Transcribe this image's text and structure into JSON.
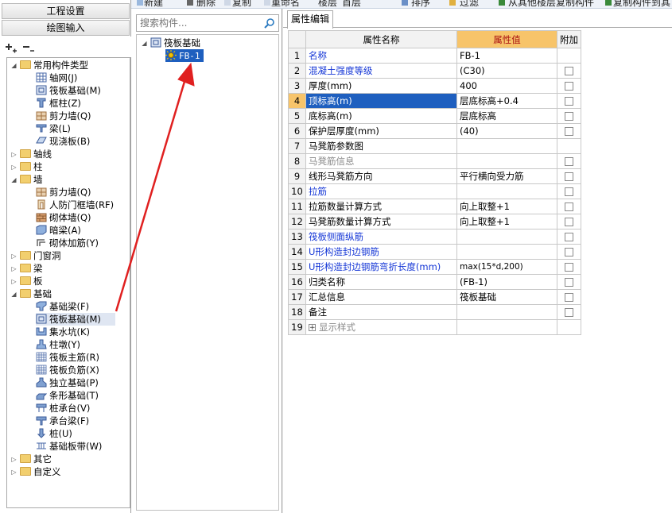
{
  "toolbar": {
    "new_label": "新建",
    "delete_label": "删除",
    "copy_label": "复制",
    "rename_label": "重命名",
    "floor_label": "楼层",
    "floor_value": "首层",
    "sort_label": "排序",
    "filter_label": "过滤",
    "copy_from_floor_label": "从其他楼层复制构件",
    "copy_to_floor_label": "复制构件到其"
  },
  "left_nav": {
    "project_settings": "工程设置",
    "drawing_input": "绘图输入"
  },
  "left_tree": {
    "common_types": "常用构件类型",
    "common_children": [
      "轴网(J)",
      "筏板基础(M)",
      "框柱(Z)",
      "剪力墙(Q)",
      "梁(L)",
      "现浇板(B)"
    ],
    "axis": "轴线",
    "column": "柱",
    "wall": "墙",
    "wall_children": [
      "剪力墙(Q)",
      "人防门框墙(RF)",
      "砌体墙(Q)",
      "暗梁(A)",
      "砌体加筋(Y)"
    ],
    "door_window": "门窗洞",
    "beam": "梁",
    "slab": "板",
    "foundation": "基础",
    "foundation_children": [
      "基础梁(F)",
      "筏板基础(M)",
      "集水坑(K)",
      "柱墩(Y)",
      "筏板主筋(R)",
      "筏板负筋(X)",
      "独立基础(P)",
      "条形基础(T)",
      "桩承台(V)",
      "承台梁(F)",
      "桩(U)",
      "基础板带(W)"
    ],
    "other": "其它",
    "custom": "自定义"
  },
  "middle": {
    "search_placeholder": "搜索构件...",
    "root": "筏板基础",
    "child": "FB-1"
  },
  "properties": {
    "tab": "属性编辑",
    "col_name": "属性名称",
    "col_value": "属性值",
    "col_add": "附加",
    "rows": [
      {
        "n": "1",
        "name": "名称",
        "value": "FB-1",
        "style": "blue",
        "cb": false
      },
      {
        "n": "2",
        "name": "混凝土强度等级",
        "value": "(C30)",
        "style": "blue",
        "cb": true
      },
      {
        "n": "3",
        "name": "厚度(mm)",
        "value": "400",
        "style": "",
        "cb": true
      },
      {
        "n": "4",
        "name": "顶标高(m)",
        "value": "层底标高+0.4",
        "style": "",
        "cb": true
      },
      {
        "n": "5",
        "name": "底标高(m)",
        "value": "层底标高",
        "style": "",
        "cb": true
      },
      {
        "n": "6",
        "name": "保护层厚度(mm)",
        "value": "(40)",
        "style": "",
        "cb": true
      },
      {
        "n": "7",
        "name": "马凳筋参数图",
        "value": "",
        "style": "",
        "cb": false
      },
      {
        "n": "8",
        "name": "马凳筋信息",
        "value": "",
        "style": "grey",
        "cb": true
      },
      {
        "n": "9",
        "name": "线形马凳筋方向",
        "value": "平行横向受力筋",
        "style": "",
        "cb": true
      },
      {
        "n": "10",
        "name": "拉筋",
        "value": "",
        "style": "blue",
        "cb": true
      },
      {
        "n": "11",
        "name": "拉筋数量计算方式",
        "value": "向上取整+1",
        "style": "",
        "cb": true
      },
      {
        "n": "12",
        "name": "马凳筋数量计算方式",
        "value": "向上取整+1",
        "style": "",
        "cb": true
      },
      {
        "n": "13",
        "name": "筏板侧面纵筋",
        "value": "",
        "style": "blue",
        "cb": true
      },
      {
        "n": "14",
        "name": "U形构造封边钢筋",
        "value": "",
        "style": "blue",
        "cb": true
      },
      {
        "n": "15",
        "name": "U形构造封边钢筋弯折长度(mm)",
        "value": "max(15*d,200)",
        "style": "blue",
        "cb": true
      },
      {
        "n": "16",
        "name": "归类名称",
        "value": "(FB-1)",
        "style": "",
        "cb": true
      },
      {
        "n": "17",
        "name": "汇总信息",
        "value": "筏板基础",
        "style": "",
        "cb": true
      },
      {
        "n": "18",
        "name": "备注",
        "value": "",
        "style": "",
        "cb": true
      },
      {
        "n": "19",
        "name": "显示样式",
        "value": "",
        "style": "grey",
        "cb": false
      }
    ]
  },
  "colors": {
    "header_value_bg": "#f7c46a",
    "selection_blue": "#1e5fbf",
    "link_blue": "#1436d6",
    "arrow_red": "#e02020"
  }
}
